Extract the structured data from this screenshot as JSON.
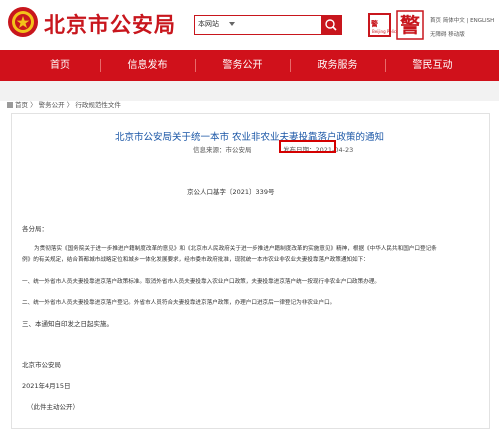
{
  "header": {
    "site_title": "北京市公安局",
    "search_scope": "本网站",
    "links_row1": "首页  简体中文  |  ENGLISH",
    "links_row2": "无障碍    移动版",
    "brand_mark": "警",
    "app_label": "北京警察学院",
    "app_sub": "Beijing Police"
  },
  "nav": [
    {
      "label": "首页"
    },
    {
      "label": "信息发布"
    },
    {
      "label": "警务公开"
    },
    {
      "label": "政务服务"
    },
    {
      "label": "警民互动"
    }
  ],
  "breadcrumb": {
    "home": "首页",
    "sep1": "〉",
    "level1": "警务公开",
    "sep2": "〉",
    "level2": "行政规范性文件"
  },
  "article": {
    "title": "北京市公安局关于统一本市 农业非农业夫妻投靠落户政策的通知",
    "source_label": "信息来源：市公安局",
    "date_label": "发布日期：",
    "date": "2021-04-23",
    "doc_no": "京公人口基字〔2021〕339号",
    "salutation": "各分局：",
    "para1_line1": "为贯彻落实《国务院关于进一步推进户籍制度改革的意见》和《北京市人民政府关于进一步推进户籍制度改革的实施意见》精神，根据《中华人民共和国户口登记条",
    "para1_line2": "例》的有关规定，结合首都城市战略定位和城乡一体化发展要求，经市委市政府批准，现就统一本市农业非农业夫妻投靠落户政策通知如下：",
    "item1": "一、统一外省市人员夫妻投靠进京落户政策标准。取消外省市人员夫妻投靠入农业户口政策，夫妻投靠进京落户统一按现行非农业户口政策办理。",
    "item2": "二、统一外省市人员夫妻投靠进京落户登记。外省市人员符合夫妻投靠进京落户政策，办理户口进京后一律登记为非农业户口。",
    "item3": "三、本通知自印发之日起实施。",
    "signature": "北京市公安局",
    "sign_date": "2021年4月15日",
    "note": "（此件主动公开）"
  },
  "colors": {
    "brand_red": "#c8161d",
    "nav_red": "#d0111b",
    "title_blue": "#1a56a6"
  }
}
